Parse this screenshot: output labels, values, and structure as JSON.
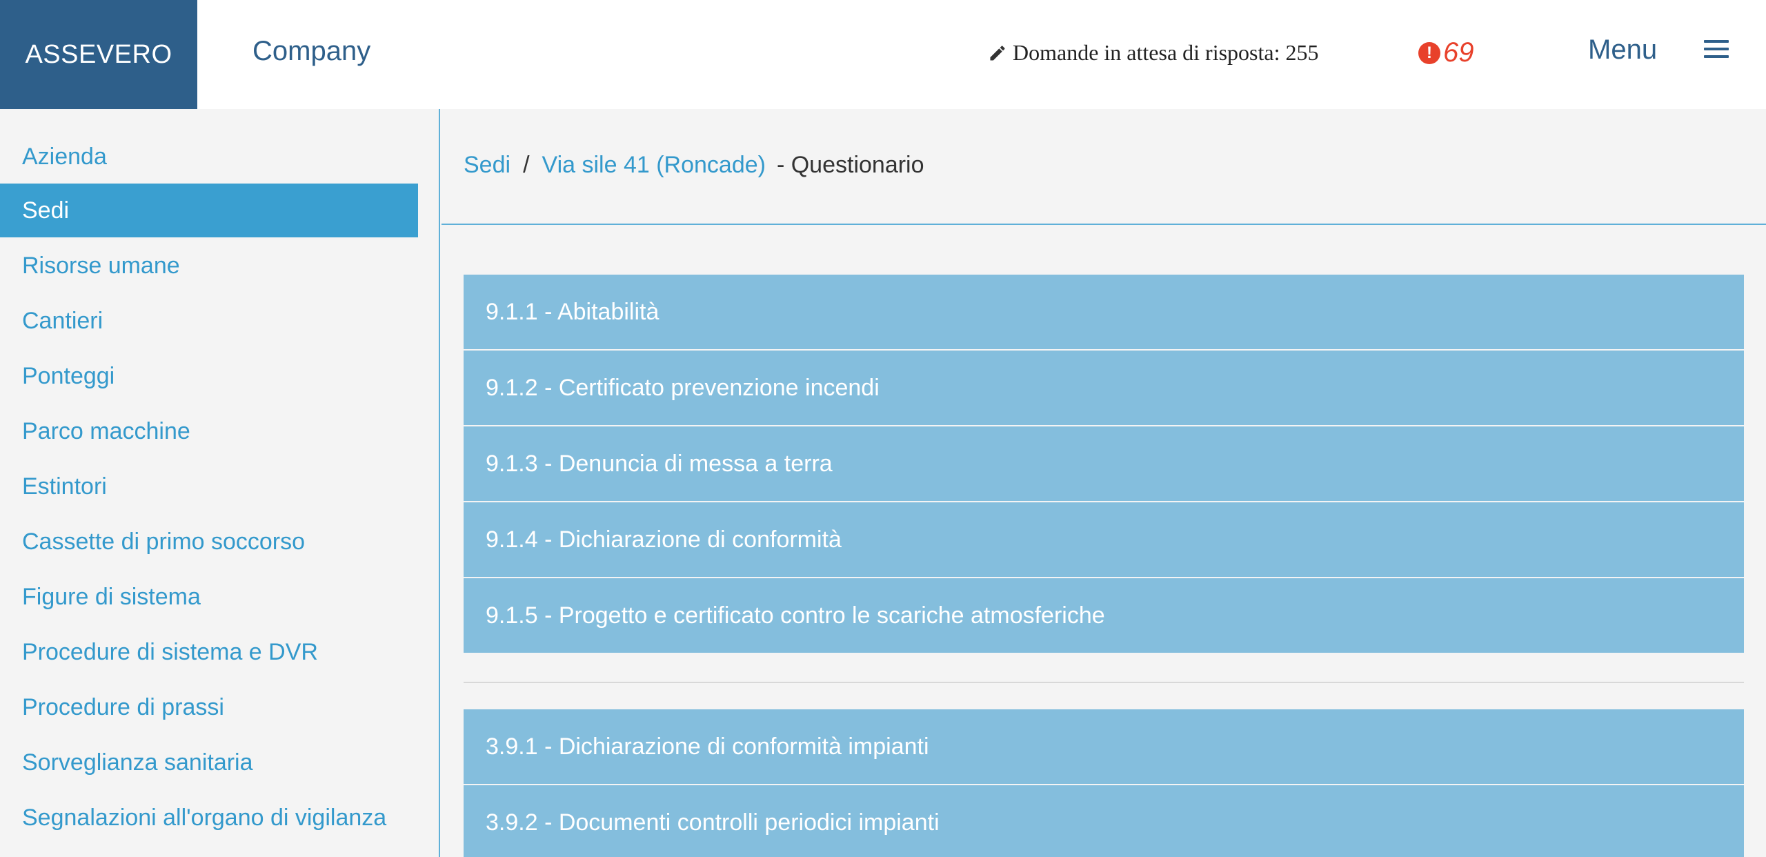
{
  "header": {
    "brand": "ASSEVERO",
    "company": "Company",
    "pending_label": "Domande in attesa di risposta: 255",
    "alert_count": "69",
    "alert_symbol": "!",
    "menu_label": "Menu",
    "colors": {
      "brand_bg": "#2e5f8a",
      "alert": "#e8412b"
    }
  },
  "sidebar": {
    "items": [
      {
        "label": "Azienda"
      },
      {
        "label": "Sedi",
        "active": true
      },
      {
        "label": "Risorse umane"
      },
      {
        "label": "Cantieri"
      },
      {
        "label": "Ponteggi"
      },
      {
        "label": "Parco macchine"
      },
      {
        "label": "Estintori"
      },
      {
        "label": "Cassette di primo soccorso"
      },
      {
        "label": "Figure di sistema"
      },
      {
        "label": "Procedure di sistema e DVR"
      },
      {
        "label": "Procedure di prassi"
      },
      {
        "label": "Sorveglianza sanitaria"
      },
      {
        "label": "Segnalazioni all'organo di vigilanza"
      }
    ]
  },
  "breadcrumb": {
    "root": "Sedi",
    "separator": "/",
    "location": "Via sile 41 (Roncade)",
    "current": "- Questionario"
  },
  "questionnaire": {
    "group1": [
      {
        "label": "9.1.1 - Abitabilità"
      },
      {
        "label": "9.1.2 - Certificato prevenzione incendi"
      },
      {
        "label": "9.1.3 - Denuncia di messa a terra"
      },
      {
        "label": "9.1.4 - Dichiarazione di conformità"
      },
      {
        "label": "9.1.5 - Progetto e certificato contro le scariche atmosferiche"
      }
    ],
    "group2": [
      {
        "label": "3.9.1 - Dichiarazione di conformità impianti"
      },
      {
        "label": "3.9.2 - Documenti controlli periodici impianti"
      }
    ]
  },
  "icons": {
    "pending": "pencil-icon",
    "alert": "exclamation-circle-icon",
    "menu": "hamburger-icon"
  }
}
